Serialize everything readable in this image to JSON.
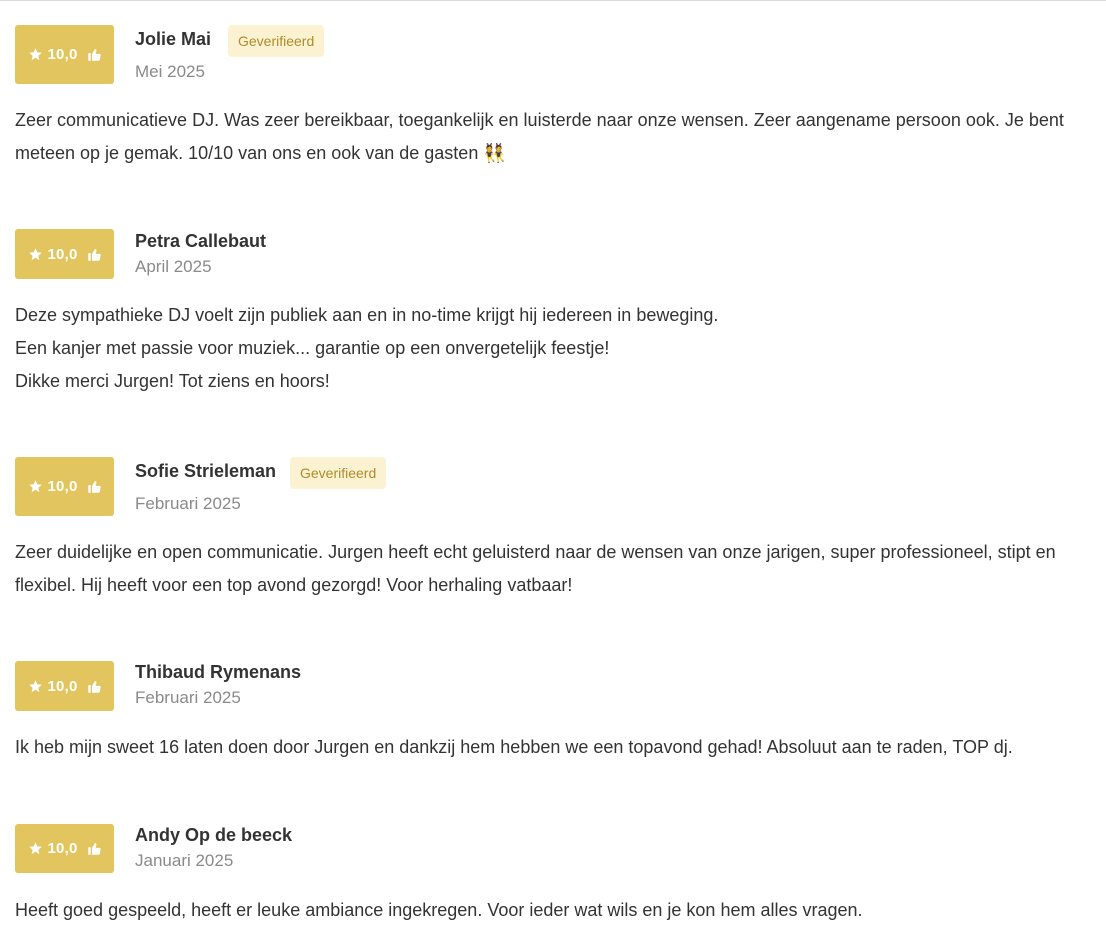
{
  "reviews": [
    {
      "score": "10,0",
      "name": "Jolie Mai",
      "verified": "Geverifieerd",
      "date": "Mei 2025",
      "lines": [
        "Zeer communicatieve DJ. Was zeer bereikbaar, toegankelijk en luisterde naar onze wensen. Zeer aangename persoon ook. Je bent meteen op je gemak. 10/10 van ons en ook van de gasten 👯"
      ]
    },
    {
      "score": "10,0",
      "name": "Petra Callebaut",
      "date": "April 2025",
      "lines": [
        "Deze sympathieke DJ voelt zijn publiek aan en in no-time krijgt hij iedereen in beweging.",
        "Een kanjer met passie voor muziek... garantie op een onvergetelijk feestje!",
        "Dikke merci Jurgen! Tot ziens en hoors!"
      ]
    },
    {
      "score": "10,0",
      "name": "Sofie Strieleman",
      "verified": "Geverifieerd",
      "date": "Februari 2025",
      "lines": [
        "Zeer duidelijke en open communicatie. Jurgen heeft echt geluisterd naar de wensen van onze jarigen, super professioneel, stipt en flexibel. Hij heeft voor een top avond gezorgd! Voor herhaling vatbaar!"
      ]
    },
    {
      "score": "10,0",
      "name": "Thibaud Rymenans",
      "date": "Februari 2025",
      "lines": [
        "Ik heb mijn sweet 16 laten doen door Jurgen en dankzij hem hebben we een topavond gehad! Absoluut aan te raden, TOP dj."
      ]
    },
    {
      "score": "10,0",
      "name": "Andy Op de beeck",
      "date": "Januari 2025",
      "lines": [
        "Heeft goed gespeeld, heeft er leuke ambiance ingekregen. Voor ieder wat wils en je kon hem alles vragen."
      ]
    }
  ],
  "colors": {
    "badge": "#e3c560",
    "verified_bg": "#fbf2d2",
    "verified_text": "#b08c2a",
    "date": "#8a8a8a",
    "text": "#333333"
  },
  "icons": {
    "score_left": "star-icon",
    "score_right": "thumbs-up-icon"
  }
}
